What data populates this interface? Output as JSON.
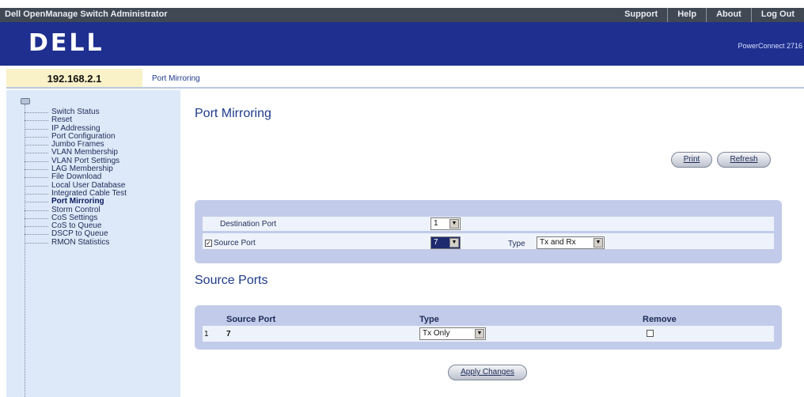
{
  "topbar": {
    "title": "Dell OpenManage Switch Administrator",
    "links": [
      "Support",
      "Help",
      "About",
      "Log Out"
    ]
  },
  "banner": {
    "logo": "DELL",
    "model": "PowerConnect 2716"
  },
  "header": {
    "ip": "192.168.2.1",
    "breadcrumb": "Port Mirroring"
  },
  "sidebar": {
    "items": [
      {
        "label": "Switch Status",
        "active": false
      },
      {
        "label": "Reset",
        "active": false
      },
      {
        "label": "IP Addressing",
        "active": false
      },
      {
        "label": "Port Configuration",
        "active": false
      },
      {
        "label": "Jumbo Frames",
        "active": false
      },
      {
        "label": "VLAN Membership",
        "active": false
      },
      {
        "label": "VLAN Port Settings",
        "active": false
      },
      {
        "label": "LAG Membership",
        "active": false
      },
      {
        "label": "File Download",
        "active": false
      },
      {
        "label": "Local User Database",
        "active": false
      },
      {
        "label": "Integrated Cable Test",
        "active": false
      },
      {
        "label": "Port Mirroring",
        "active": true
      },
      {
        "label": "Storm Control",
        "active": false
      },
      {
        "label": "CoS Settings",
        "active": false
      },
      {
        "label": "CoS to Queue",
        "active": false
      },
      {
        "label": "DSCP to Queue",
        "active": false
      },
      {
        "label": "RMON Statistics",
        "active": false
      }
    ]
  },
  "main": {
    "title": "Port Mirroring",
    "print_label": "Print",
    "refresh_label": "Refresh",
    "destination_port_label": "Destination Port",
    "destination_port_value": "1",
    "source_port_label": "Source Port",
    "source_port_checked": true,
    "source_port_value": "7",
    "type_label": "Type",
    "type_value": "Tx and Rx",
    "source_ports_title": "Source Ports",
    "table": {
      "headers": [
        "Source Port",
        "Type",
        "Remove"
      ],
      "rows": [
        {
          "index": "1",
          "source_port": "7",
          "type": "Tx Only",
          "remove": false
        }
      ]
    },
    "apply_label": "Apply Changes"
  },
  "colors": {
    "topbar": "#404854",
    "banner": "#1e2f8f",
    "sidebar": "#dde9f8",
    "panel": "#c2cbe9",
    "title": "#1e3a8a"
  }
}
